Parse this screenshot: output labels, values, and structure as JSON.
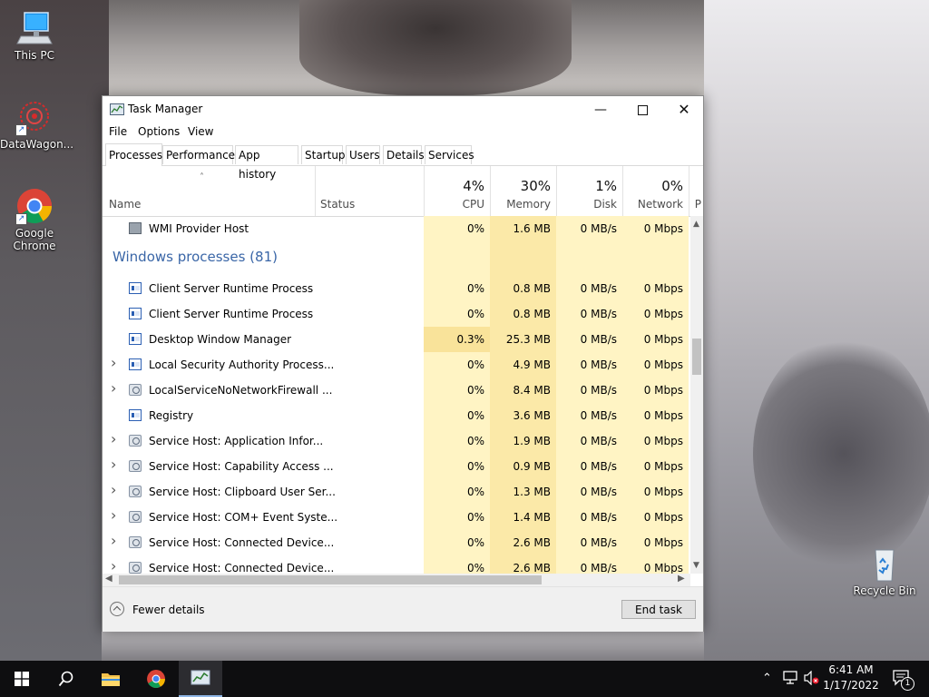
{
  "desktop": {
    "icons": [
      {
        "label": "This PC"
      },
      {
        "label": "DataWagon..."
      },
      {
        "label": "Google Chrome"
      },
      {
        "label": "Recycle Bin"
      }
    ]
  },
  "window": {
    "title": "Task Manager",
    "menu": [
      "File",
      "Options",
      "View"
    ],
    "tabs": [
      "Processes",
      "Performance",
      "App history",
      "Startup",
      "Users",
      "Details",
      "Services"
    ],
    "active_tab": "Processes"
  },
  "columns": {
    "name": "Name",
    "status": "Status",
    "cpu": {
      "pct": "4%",
      "label": "CPU"
    },
    "memory": {
      "pct": "30%",
      "label": "Memory"
    },
    "disk": {
      "pct": "1%",
      "label": "Disk"
    },
    "network": {
      "pct": "0%",
      "label": "Network"
    },
    "power_partial": "P"
  },
  "rows": [
    {
      "type": "process",
      "name": "WMI Provider Host",
      "icon": "wmi-icon",
      "expand": false,
      "cpu": "0%",
      "memory": "1.6 MB",
      "disk": "0 MB/s",
      "network": "0 Mbps"
    },
    {
      "type": "group",
      "title": "Windows processes (81)"
    },
    {
      "type": "process",
      "name": "Client Server Runtime Process",
      "icon": "window-icon",
      "expand": false,
      "cpu": "0%",
      "memory": "0.8 MB",
      "disk": "0 MB/s",
      "network": "0 Mbps"
    },
    {
      "type": "process",
      "name": "Client Server Runtime Process",
      "icon": "window-icon",
      "expand": false,
      "cpu": "0%",
      "memory": "0.8 MB",
      "disk": "0 MB/s",
      "network": "0 Mbps"
    },
    {
      "type": "process",
      "name": "Desktop Window Manager",
      "icon": "window-icon",
      "expand": false,
      "cpu": "0.3%",
      "memory": "25.3 MB",
      "disk": "0 MB/s",
      "network": "0 Mbps"
    },
    {
      "type": "process",
      "name": "Local Security Authority Process...",
      "icon": "window-icon",
      "expand": true,
      "cpu": "0%",
      "memory": "4.9 MB",
      "disk": "0 MB/s",
      "network": "0 Mbps"
    },
    {
      "type": "process",
      "name": "LocalServiceNoNetworkFirewall ...",
      "icon": "gear-icon",
      "expand": true,
      "cpu": "0%",
      "memory": "8.4 MB",
      "disk": "0 MB/s",
      "network": "0 Mbps"
    },
    {
      "type": "process",
      "name": "Registry",
      "icon": "window-icon",
      "expand": false,
      "cpu": "0%",
      "memory": "3.6 MB",
      "disk": "0 MB/s",
      "network": "0 Mbps"
    },
    {
      "type": "process",
      "name": "Service Host: Application Infor...",
      "icon": "gear-icon",
      "expand": true,
      "cpu": "0%",
      "memory": "1.9 MB",
      "disk": "0 MB/s",
      "network": "0 Mbps"
    },
    {
      "type": "process",
      "name": "Service Host: Capability Access ...",
      "icon": "gear-icon",
      "expand": true,
      "cpu": "0%",
      "memory": "0.9 MB",
      "disk": "0 MB/s",
      "network": "0 Mbps"
    },
    {
      "type": "process",
      "name": "Service Host: Clipboard User Ser...",
      "icon": "gear-icon",
      "expand": true,
      "cpu": "0%",
      "memory": "1.3 MB",
      "disk": "0 MB/s",
      "network": "0 Mbps"
    },
    {
      "type": "process",
      "name": "Service Host: COM+ Event Syste...",
      "icon": "gear-icon",
      "expand": true,
      "cpu": "0%",
      "memory": "1.4 MB",
      "disk": "0 MB/s",
      "network": "0 Mbps"
    },
    {
      "type": "process",
      "name": "Service Host: Connected Device...",
      "icon": "gear-icon",
      "expand": true,
      "cpu": "0%",
      "memory": "2.6 MB",
      "disk": "0 MB/s",
      "network": "0 Mbps"
    },
    {
      "type": "process",
      "name": "Service Host: Connected Device...",
      "icon": "gear-icon",
      "expand": true,
      "cpu": "0%",
      "memory": "2.6 MB",
      "disk": "0 MB/s",
      "network": "0 Mbps"
    }
  ],
  "footer": {
    "fewer_details": "Fewer details",
    "end_task": "End task"
  },
  "taskbar": {
    "time": "6:41 AM",
    "date": "1/17/2022",
    "notification_count": "1"
  },
  "colors": {
    "cpu_col": "#fff4c4",
    "mem_col": "#fbe9a8",
    "disk_col": "#fff4c4",
    "net_col": "#fff4c4",
    "highlight_cell": "#f9e39a",
    "group_title": "#3a66a7",
    "taskbar": "#0e0e10"
  }
}
